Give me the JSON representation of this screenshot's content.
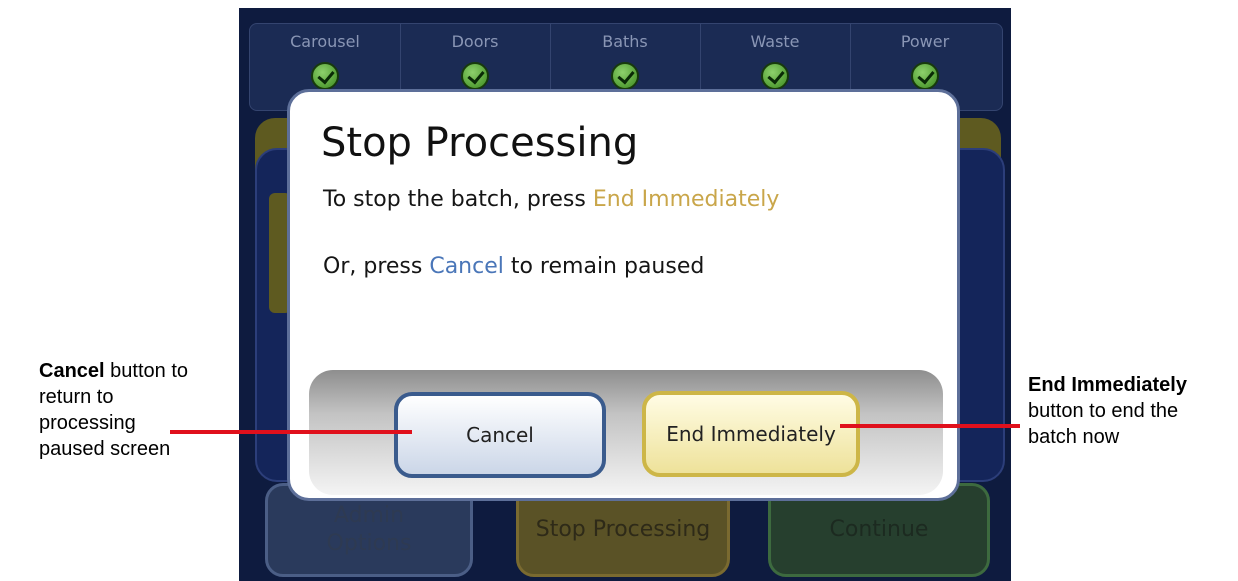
{
  "status_bar": {
    "items": [
      {
        "label": "Carousel",
        "icon": "check-icon"
      },
      {
        "label": "Doors",
        "icon": "check-icon"
      },
      {
        "label": "Baths",
        "icon": "check-icon"
      },
      {
        "label": "Waste",
        "icon": "check-icon"
      },
      {
        "label": "Power",
        "icon": "check-icon"
      }
    ]
  },
  "background_buttons": {
    "admin_line1": "Admin",
    "admin_line2": "Options",
    "stop": "Stop Processing",
    "continue": "Continue"
  },
  "dialog": {
    "title": "Stop Processing",
    "line1_prefix": "To stop the batch, press ",
    "line1_highlight": "End Immediately",
    "line2_prefix": "Or, press ",
    "line2_highlight": "Cancel",
    "line2_suffix": " to remain paused",
    "cancel_label": "Cancel",
    "end_label": "End Immediately"
  },
  "annotations": {
    "left_bold": "Cancel",
    "left_text1": " button to",
    "left_text2": "return to",
    "left_text3": "processing",
    "left_text4": "paused screen",
    "right_bold": "End Immediately",
    "right_text1": "button to end the",
    "right_text2": "batch now"
  },
  "colors": {
    "screen_bg": "#0e1b3f",
    "highlight_gold": "#c9a64a",
    "highlight_blue": "#4a76b8",
    "callout_red": "#e0101c",
    "check_green": "#4caf2a"
  }
}
